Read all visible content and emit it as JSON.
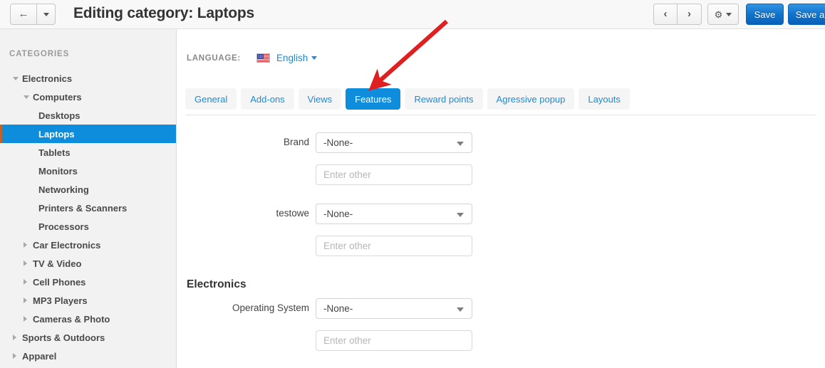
{
  "header": {
    "title": "Editing category: Laptops",
    "back_button": {
      "icon": "arrow-left-icon",
      "caret": "chevron-down-icon"
    },
    "prev_label": "‹",
    "next_label": "›",
    "gear_label": "⚙",
    "save_label": "Save",
    "save_and_label": "Save a"
  },
  "sidebar": {
    "title": "CATEGORIES",
    "items": [
      {
        "label": "Electronics",
        "level": 0,
        "toggle": "open",
        "selected": false
      },
      {
        "label": "Computers",
        "level": 1,
        "toggle": "open",
        "selected": false
      },
      {
        "label": "Desktops",
        "level": 2,
        "toggle": "none",
        "selected": false
      },
      {
        "label": "Laptops",
        "level": 2,
        "toggle": "none",
        "selected": true
      },
      {
        "label": "Tablets",
        "level": 2,
        "toggle": "none",
        "selected": false
      },
      {
        "label": "Monitors",
        "level": 2,
        "toggle": "none",
        "selected": false
      },
      {
        "label": "Networking",
        "level": 2,
        "toggle": "none",
        "selected": false
      },
      {
        "label": "Printers & Scanners",
        "level": 2,
        "toggle": "none",
        "selected": false
      },
      {
        "label": "Processors",
        "level": 2,
        "toggle": "none",
        "selected": false
      },
      {
        "label": "Car Electronics",
        "level": 1,
        "toggle": "closed",
        "selected": false
      },
      {
        "label": "TV & Video",
        "level": 1,
        "toggle": "closed",
        "selected": false
      },
      {
        "label": "Cell Phones",
        "level": 1,
        "toggle": "closed",
        "selected": false
      },
      {
        "label": "MP3 Players",
        "level": 1,
        "toggle": "closed",
        "selected": false
      },
      {
        "label": "Cameras & Photo",
        "level": 1,
        "toggle": "closed",
        "selected": false
      },
      {
        "label": "Sports & Outdoors",
        "level": 0,
        "toggle": "closed",
        "selected": false
      },
      {
        "label": "Apparel",
        "level": 0,
        "toggle": "closed",
        "selected": false
      }
    ]
  },
  "content": {
    "language": {
      "label": "LANGUAGE:",
      "flag": "us-flag-icon",
      "value": "English"
    },
    "tabs": [
      {
        "label": "General",
        "active": false
      },
      {
        "label": "Add-ons",
        "active": false
      },
      {
        "label": "Views",
        "active": false
      },
      {
        "label": "Features",
        "active": true
      },
      {
        "label": "Reward points",
        "active": false
      },
      {
        "label": "Agressive popup",
        "active": false
      },
      {
        "label": "Layouts",
        "active": false
      }
    ],
    "fields": [
      {
        "label": "Brand",
        "value": "-None-",
        "other_placeholder": "Enter other"
      },
      {
        "label": "testowe",
        "value": "-None-",
        "other_placeholder": "Enter other"
      }
    ],
    "section": {
      "heading": "Electronics",
      "fields": [
        {
          "label": "Operating System",
          "value": "-None-",
          "other_placeholder": "Enter other"
        }
      ]
    }
  },
  "annotation": {
    "type": "arrow",
    "color": "#e02020",
    "points_to": "Features"
  },
  "colors": {
    "accent_blue": "#0d8ddb",
    "link_blue": "#1c8ad6",
    "save_blue": "#1074cc",
    "selected_stripe": "#c0622a",
    "sidebar_bg": "#f2f2f2",
    "header_bg": "#f8f8f8"
  }
}
